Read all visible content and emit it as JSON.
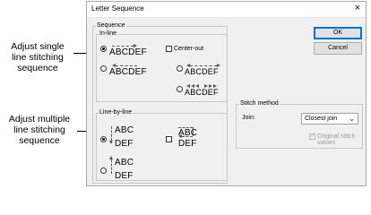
{
  "callouts": {
    "single": "Adjust single line stitching sequence",
    "multiple": "Adjust multiple line stitching sequence"
  },
  "dialog": {
    "title": "Letter Sequence",
    "close_glyph": "×",
    "sequence_group": "Sequence",
    "inline_label": "In-line",
    "inline_options": [
      "ABCDEF",
      "ABCDEF",
      "ABCDEF",
      "ABCDEF"
    ],
    "center_out_label": "Center-out",
    "line_by_line_label": "Line-by-line",
    "lbl_options": [
      {
        "top": "ABC",
        "bottom": "DEF"
      },
      {
        "top": "ABC",
        "bottom": "DEF"
      },
      {
        "top": "ABC",
        "bottom": "DEF"
      }
    ],
    "stitch_method_group": "Stitch method",
    "join_label": "Join:",
    "join_value": "Closest join",
    "original_stitch_label": "Original stitch values",
    "ok_label": "OK",
    "cancel_label": "Cancel"
  }
}
